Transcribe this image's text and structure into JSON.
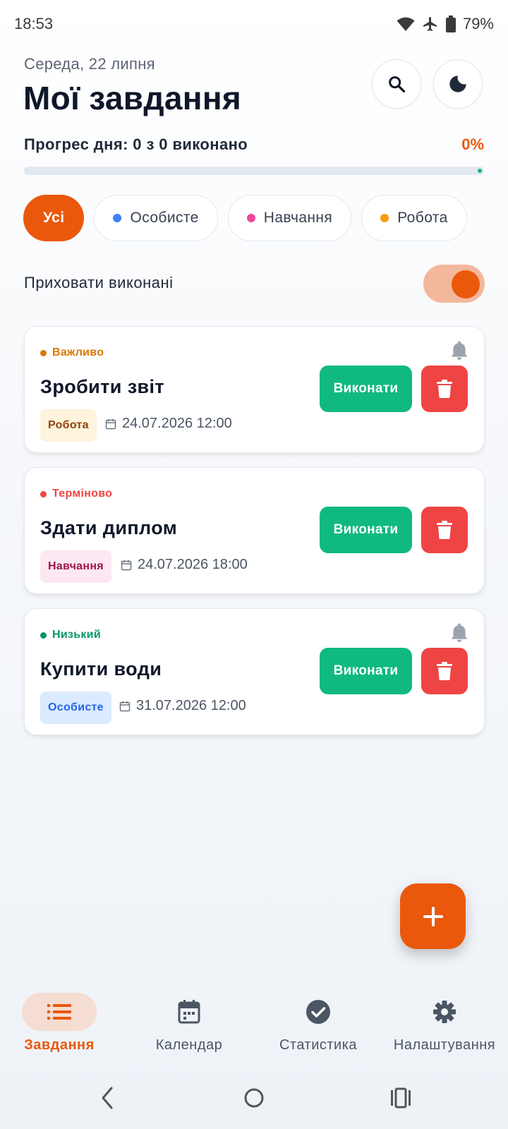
{
  "status_bar": {
    "time": "18:53",
    "battery": "79%",
    "icons": [
      "wifi-icon",
      "airplane-icon",
      "battery-icon"
    ]
  },
  "header": {
    "date": "Середа, 22 липня",
    "title": "Мої завдання",
    "actions": [
      "search-icon",
      "moon-icon"
    ]
  },
  "progress": {
    "label": "Прогрес дня: 0 з 0 виконано",
    "percent_text": "0%",
    "percent": 0
  },
  "filters": [
    {
      "label": "Усі",
      "active": true
    },
    {
      "label": "Особисте",
      "dot_color": "#3b82f6"
    },
    {
      "label": "Навчання",
      "dot_color": "#ec4899"
    },
    {
      "label": "Робота",
      "dot_color": "#f59e0b"
    }
  ],
  "hide_done": {
    "label": "Приховати виконані",
    "on": true
  },
  "tasks": [
    {
      "priority": "Важливо",
      "priority_color": "#d97706",
      "title": "Зробити звіт",
      "category": "Робота",
      "category_bg": "#fef3dc",
      "category_color": "#92400e",
      "due": "24.07.2026 12:00",
      "bell": true,
      "done_label": "Виконати"
    },
    {
      "priority": "Терміново",
      "priority_color": "#ef4444",
      "title": "Здати диплом",
      "category": "Навчання",
      "category_bg": "#fce7f3",
      "category_color": "#9d174d",
      "due": "24.07.2026 18:00",
      "bell": false,
      "done_label": "Виконати"
    },
    {
      "priority": "Низький",
      "priority_color": "#059669",
      "title": "Купити води",
      "category": "Особисте",
      "category_bg": "#dbeafe",
      "category_color": "#2563eb",
      "due": "31.07.2026 12:00",
      "bell": true,
      "done_label": "Виконати"
    }
  ],
  "nav": [
    {
      "label": "Завдання",
      "icon": "list-icon",
      "active": true
    },
    {
      "label": "Календар",
      "icon": "calendar-icon"
    },
    {
      "label": "Статистика",
      "icon": "check-circle-icon"
    },
    {
      "label": "Налаштування",
      "icon": "gear-icon"
    }
  ],
  "colors": {
    "accent": "#ea580c",
    "success": "#10b981",
    "danger": "#ef4444"
  }
}
